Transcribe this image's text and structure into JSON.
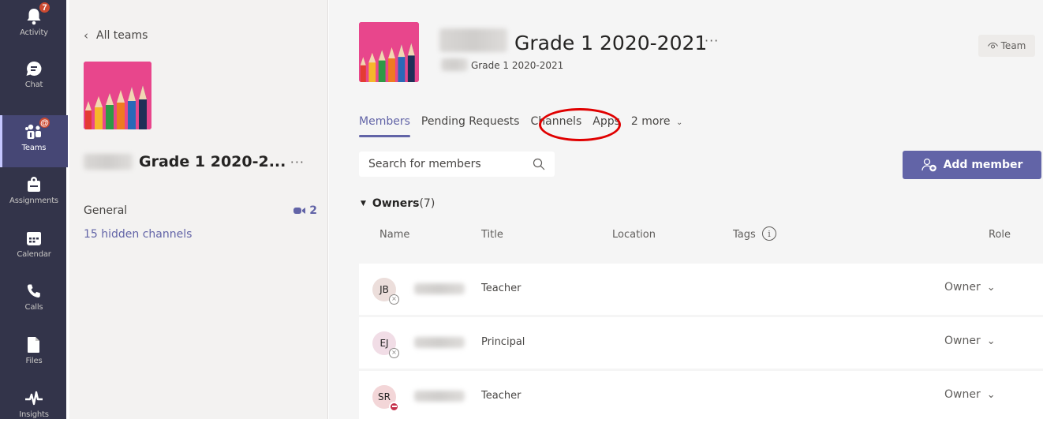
{
  "rail": {
    "items": [
      {
        "label": "Activity",
        "icon": "bell-icon",
        "badge": "7"
      },
      {
        "label": "Chat",
        "icon": "chat-icon",
        "badge": ""
      },
      {
        "label": "Teams",
        "icon": "teams-icon",
        "badge": "@",
        "active": true
      },
      {
        "label": "Assignments",
        "icon": "assignments-icon",
        "badge": ""
      },
      {
        "label": "Calendar",
        "icon": "calendar-icon",
        "badge": ""
      },
      {
        "label": "Calls",
        "icon": "phone-icon",
        "badge": ""
      },
      {
        "label": "Files",
        "icon": "file-icon",
        "badge": ""
      },
      {
        "label": "Insights",
        "icon": "pulse-icon",
        "badge": ""
      }
    ]
  },
  "team_panel": {
    "back_label": "All teams",
    "team_name": "Grade 1 2020-2...",
    "more": "···",
    "channels": [
      {
        "name": "General",
        "call_count": "2"
      }
    ],
    "hidden_channels": "15 hidden channels"
  },
  "header": {
    "title": "Grade 1 2020-2021",
    "more": "···",
    "subtitle": "Grade 1 2020-2021",
    "team_button": "Team"
  },
  "tabs": [
    {
      "label": "Members",
      "active": true
    },
    {
      "label": "Pending Requests"
    },
    {
      "label": "Channels"
    },
    {
      "label": "Apps"
    },
    {
      "label": "2 more"
    }
  ],
  "search": {
    "placeholder": "Search for members"
  },
  "add_member_label": "Add member",
  "owners": {
    "label": "Owners",
    "count": "(7)"
  },
  "columns": {
    "name": "Name",
    "title": "Title",
    "location": "Location",
    "tags": "Tags",
    "role": "Role"
  },
  "members": [
    {
      "initials": "JB",
      "title": "Teacher",
      "role": "Owner",
      "avatar_color": "#ecdedb",
      "status": "offline"
    },
    {
      "initials": "EJ",
      "title": "Principal",
      "role": "Owner",
      "avatar_color": "#f1dde6",
      "status": "offline"
    },
    {
      "initials": "SR",
      "title": "Teacher",
      "role": "Owner",
      "avatar_color": "#f3d6d8",
      "status": "dnd"
    }
  ],
  "colors": {
    "accent": "#6264a7",
    "rail": "#33344a",
    "highlight_circle": "#e00000"
  }
}
